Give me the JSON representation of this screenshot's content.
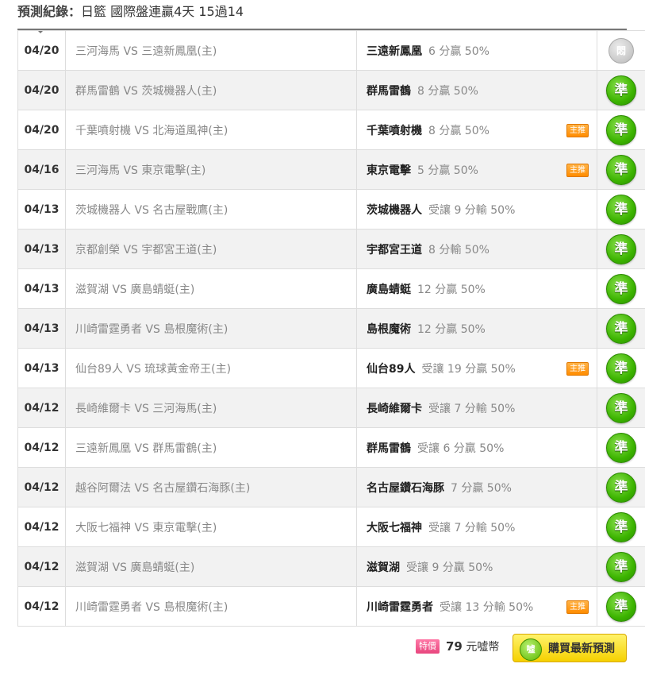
{
  "header": {
    "label": "預測紀錄：",
    "summary": "日籃 國際盤連贏4天 15過14"
  },
  "rows": [
    {
      "date": "04/20",
      "match": "三河海馬 VS 三遠新鳳凰(主)",
      "pick_team": "三遠新鳳凰",
      "pick_odds": "6 分贏 50%",
      "main": "",
      "result": "悶",
      "status": "pending"
    },
    {
      "date": "04/20",
      "match": "群馬雷鶴 VS 茨城機器人(主)",
      "pick_team": "群馬雷鶴",
      "pick_odds": "8 分贏 50%",
      "main": "",
      "result": "準",
      "status": "ok"
    },
    {
      "date": "04/20",
      "match": "千葉噴射機 VS 北海道風神(主)",
      "pick_team": "千葉噴射機",
      "pick_odds": "8 分贏 50%",
      "main": "主推",
      "result": "準",
      "status": "ok"
    },
    {
      "date": "04/16",
      "match": "三河海馬 VS 東京電擊(主)",
      "pick_team": "東京電擊",
      "pick_odds": "5 分贏 50%",
      "main": "主推",
      "result": "準",
      "status": "ok"
    },
    {
      "date": "04/13",
      "match": "茨城機器人 VS 名古屋戰鷹(主)",
      "pick_team": "茨城機器人",
      "pick_odds": "受讓 9 分輸 50%",
      "main": "",
      "result": "準",
      "status": "ok"
    },
    {
      "date": "04/13",
      "match": "京都創榮 VS 宇都宮王道(主)",
      "pick_team": "宇都宮王道",
      "pick_odds": "8 分輸 50%",
      "main": "",
      "result": "準",
      "status": "ok"
    },
    {
      "date": "04/13",
      "match": "滋賀湖 VS 廣島蜻蜓(主)",
      "pick_team": "廣島蜻蜓",
      "pick_odds": "12 分贏 50%",
      "main": "",
      "result": "準",
      "status": "ok"
    },
    {
      "date": "04/13",
      "match": "川崎雷霆勇者 VS 島根魔術(主)",
      "pick_team": "島根魔術",
      "pick_odds": "12 分贏 50%",
      "main": "",
      "result": "準",
      "status": "ok"
    },
    {
      "date": "04/13",
      "match": "仙台89人 VS 琉球黃金帝王(主)",
      "pick_team": "仙台89人",
      "pick_odds": "受讓 19 分贏 50%",
      "main": "主推",
      "result": "準",
      "status": "ok"
    },
    {
      "date": "04/12",
      "match": "長崎維爾卡 VS 三河海馬(主)",
      "pick_team": "長崎維爾卡",
      "pick_odds": "受讓 7 分輸 50%",
      "main": "",
      "result": "準",
      "status": "ok"
    },
    {
      "date": "04/12",
      "match": "三遠新鳳凰 VS 群馬雷鶴(主)",
      "pick_team": "群馬雷鶴",
      "pick_odds": "受讓 6 分贏 50%",
      "main": "",
      "result": "準",
      "status": "ok"
    },
    {
      "date": "04/12",
      "match": "越谷阿爾法 VS 名古屋鑽石海豚(主)",
      "pick_team": "名古屋鑽石海豚",
      "pick_odds": "7 分贏 50%",
      "main": "",
      "result": "準",
      "status": "ok"
    },
    {
      "date": "04/12",
      "match": "大阪七福神 VS 東京電擊(主)",
      "pick_team": "大阪七福神",
      "pick_odds": "受讓 7 分輸 50%",
      "main": "",
      "result": "準",
      "status": "ok"
    },
    {
      "date": "04/12",
      "match": "滋賀湖 VS 廣島蜻蜓(主)",
      "pick_team": "滋賀湖",
      "pick_odds": "受讓 9 分贏 50%",
      "main": "",
      "result": "準",
      "status": "ok"
    },
    {
      "date": "04/12",
      "match": "川崎雷霆勇者 VS 島根魔術(主)",
      "pick_team": "川崎雷霆勇者",
      "pick_odds": "受讓 13 分輸 50%",
      "main": "主推",
      "result": "準",
      "status": "ok"
    }
  ],
  "footer": {
    "special_label": "特價",
    "price_amount": "79",
    "price_unit": "元噓幣",
    "buy_icon_text": "噓",
    "buy_label": "購買最新預測"
  },
  "colors": {
    "ok": "#3cb400",
    "pending": "#c8c8c8",
    "main_badge": "#ff8c00",
    "buy_button": "#f5d100"
  }
}
